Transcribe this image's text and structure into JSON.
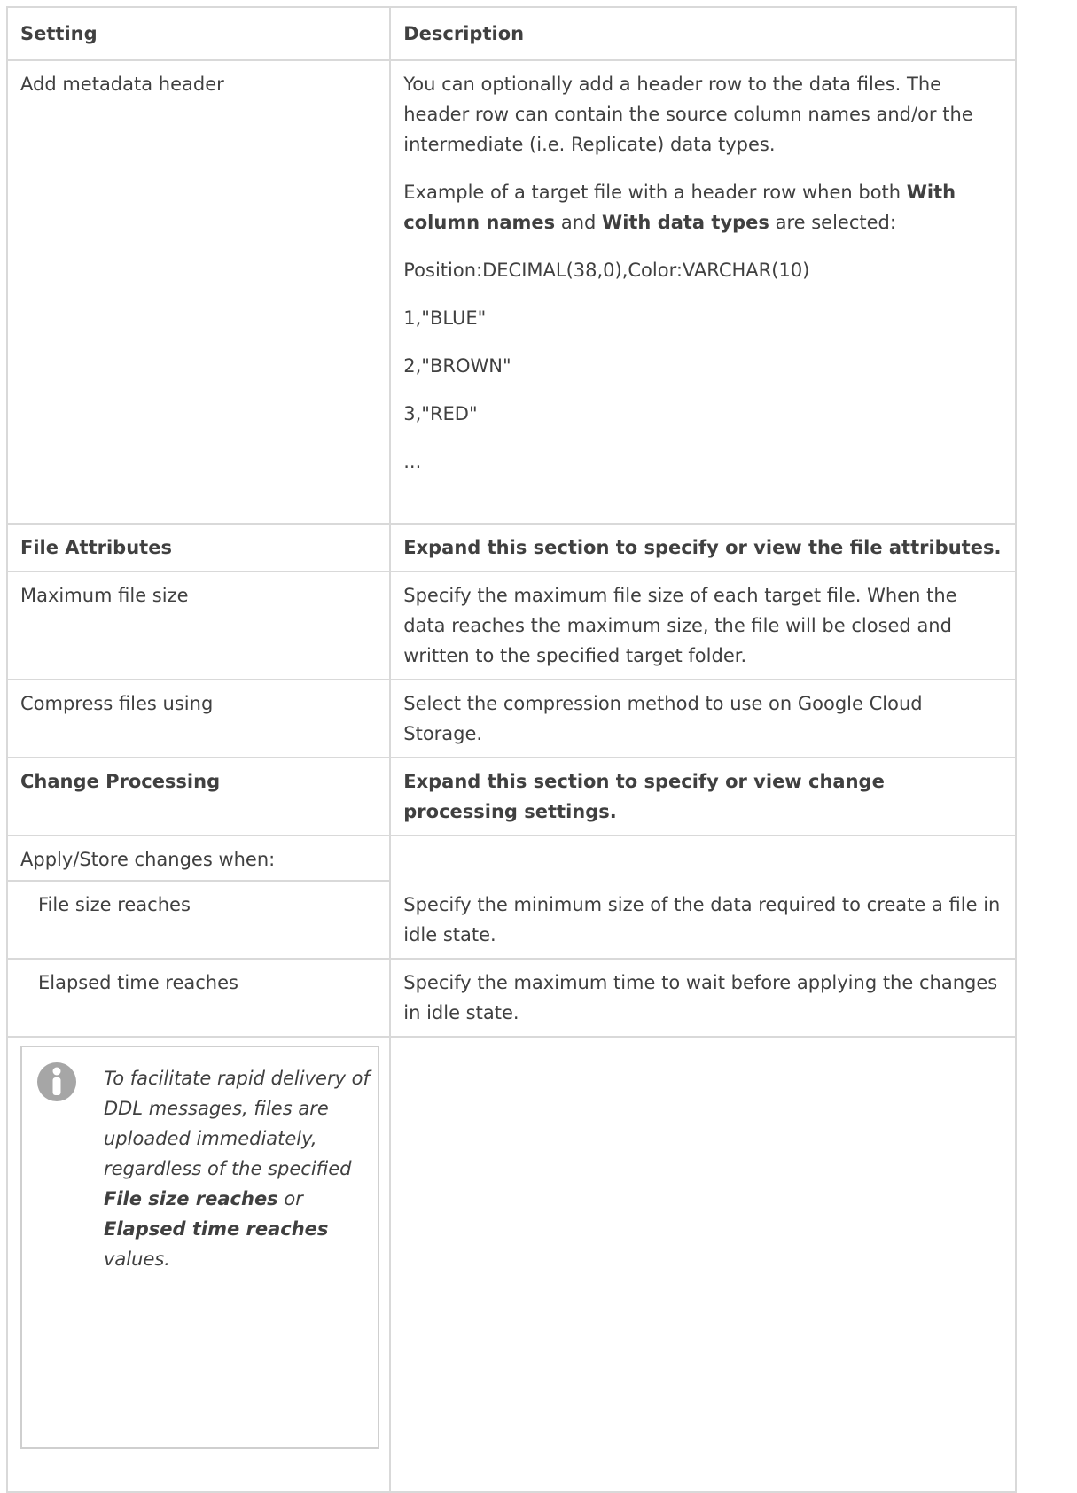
{
  "table": {
    "header": {
      "setting": "Setting",
      "description": "Description"
    },
    "metadata_header": {
      "setting": "Add metadata header",
      "desc_p1": "You can optionally add a header row to the data files. The header row can contain the source column names and/or the intermediate (i.e. Replicate) data types.",
      "desc_p2_pre": "Example of a target file with a header row when both ",
      "desc_p2_bold1": "With column names",
      "desc_p2_mid": " and ",
      "desc_p2_bold2": "With data types",
      "desc_p2_post": " are selected:",
      "example_header": "Position:DECIMAL(38,0),Color:VARCHAR(10)",
      "example_row1": "1,\"BLUE\"",
      "example_row2": "2,\"BROWN\"",
      "example_row3": "3,\"RED\"",
      "example_ellipsis": "..."
    },
    "file_attributes": {
      "setting": "File Attributes",
      "description": "Expand this section to specify or view the file attributes."
    },
    "max_file_size": {
      "setting": "Maximum file size",
      "description": "Specify the maximum file size of each target file. When the data reaches the maximum size, the file will be closed and written to the specified target folder."
    },
    "compress_files": {
      "setting": "Compress files using",
      "description": "Select the compression method to use on Google Cloud Storage."
    },
    "change_processing": {
      "setting": "Change Processing",
      "description": "Expand this section to specify or view change processing settings."
    },
    "apply_store": {
      "setting": "Apply/Store changes when:"
    },
    "file_size_reaches": {
      "setting": "File size reaches",
      "description": "Specify the minimum size of the data required to create a file in idle state."
    },
    "elapsed_time_reaches": {
      "setting": "Elapsed time reaches",
      "description": "Specify the maximum time to wait before applying the changes in idle state."
    },
    "note": {
      "icon": "info-icon",
      "text_pre": "To facilitate rapid delivery of DDL messages, files are uploaded immediately, regardless of the specified ",
      "bold1": "File size reaches",
      "text_mid": " or ",
      "bold2": "Elapsed time reaches",
      "text_post": " values."
    }
  },
  "colors": {
    "border": "#d9d9d9",
    "text": "#404040",
    "icon": "#a6a6a6"
  }
}
